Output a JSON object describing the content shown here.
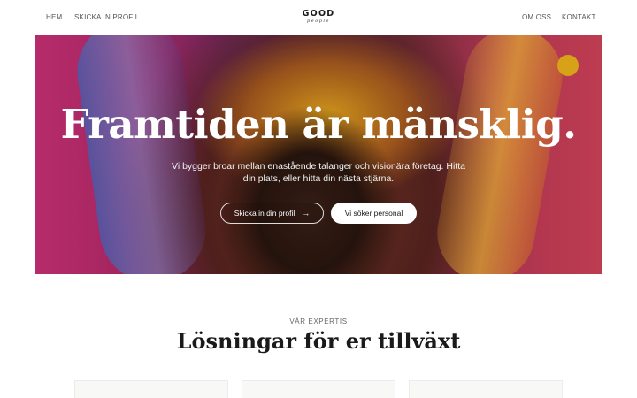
{
  "nav": {
    "left_links": [
      "HEM",
      "SKICKA IN PROFIL"
    ],
    "right_links": [
      "OM OSS",
      "KONTAKT"
    ],
    "logo": {
      "word": "GOOD",
      "sub": "people"
    }
  },
  "hero": {
    "title": "Framtiden är mänsklig.",
    "subtitle": "Vi bygger broar mellan enastående talanger och visionära företag. Hitta din plats, eller hitta din nästa stjärna.",
    "primary_cta": {
      "label": "Skicka in din profil",
      "icon": "arrow-right-icon",
      "arrow": "→"
    },
    "secondary_cta": {
      "label": "Vi söker personal"
    }
  },
  "expertise": {
    "eyebrow": "VÅR EXPERTIS",
    "title": "Lösningar för er tillväxt"
  },
  "colors": {
    "accent_gold": "#f5b81c",
    "accent_magenta": "#d0327a",
    "text_dark": "#1a1a1a"
  }
}
